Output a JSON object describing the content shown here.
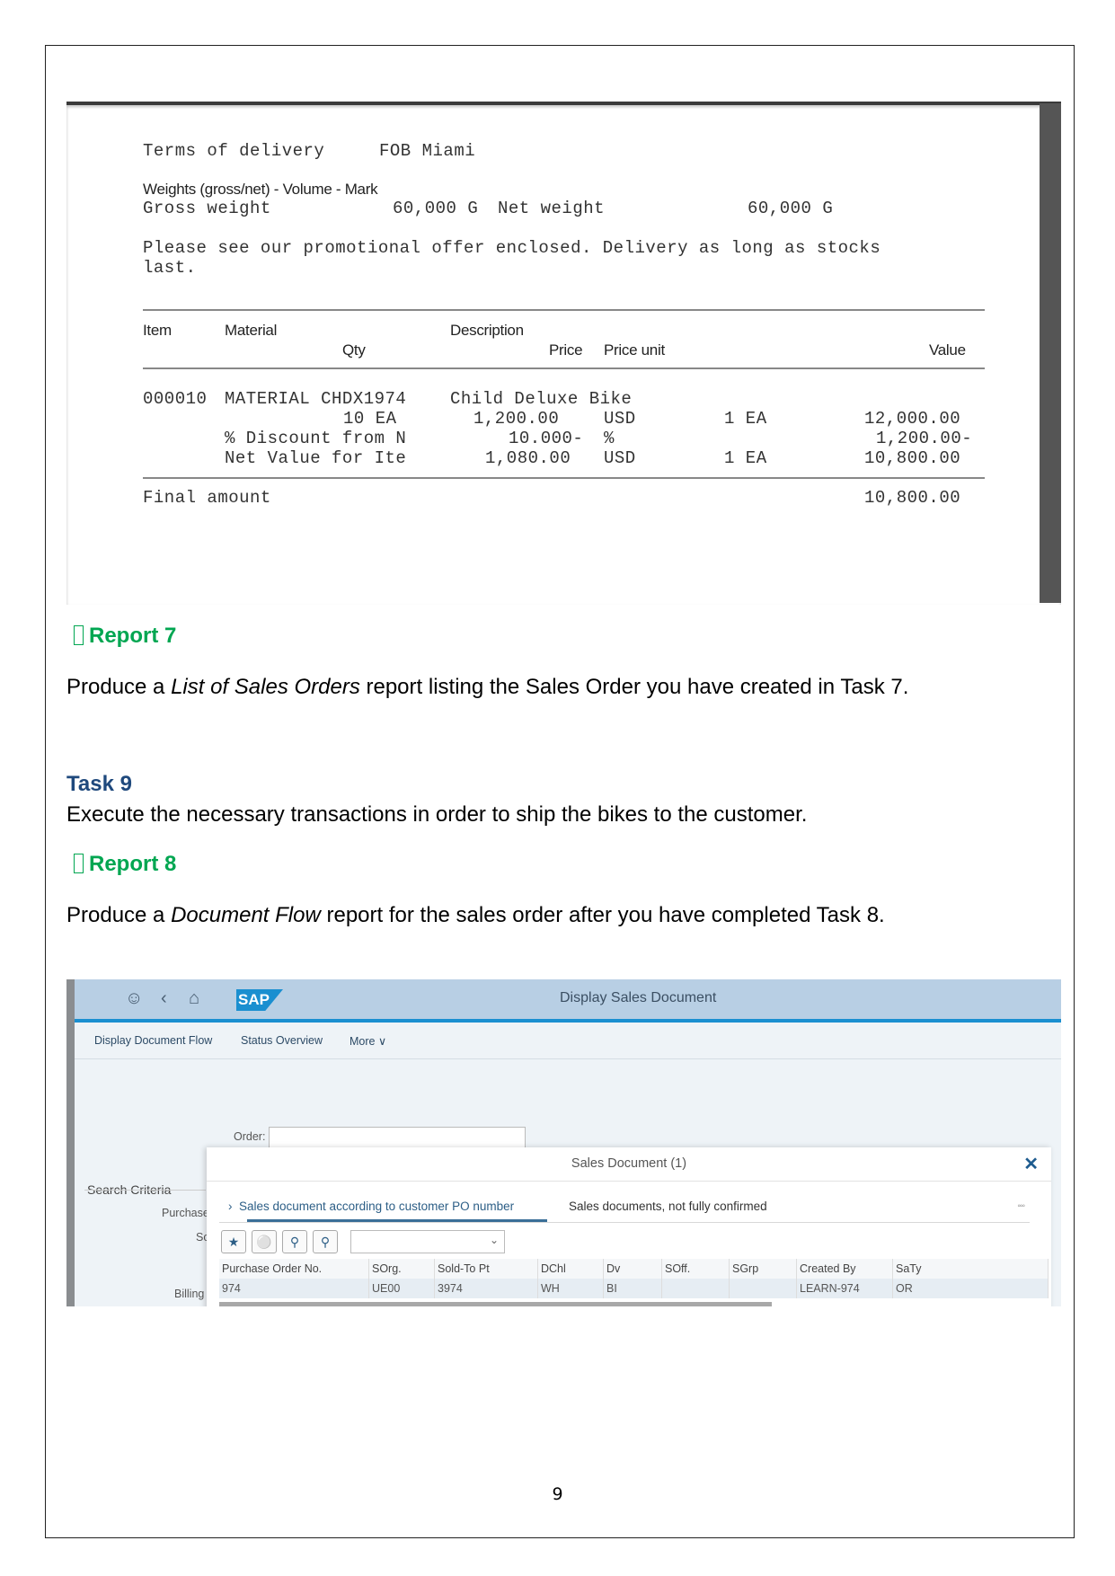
{
  "invoice": {
    "terms_label": "Terms of delivery",
    "terms_value": "FOB Miami",
    "weights_header": "Weights (gross/net) - Volume - Mark",
    "gross_weight_label": "Gross weight",
    "gross_weight_value": "60,000 G",
    "net_weight_label": "Net weight",
    "net_weight_value": "60,000 G",
    "promo_line1": "Please see our promotional offer enclosed. Delivery as long as stocks",
    "promo_line2": "last.",
    "columns": {
      "item": "Item",
      "material": "Material",
      "qty": "Qty",
      "description": "Description",
      "price": "Price",
      "price_unit": "Price unit",
      "value": "Value"
    },
    "line_item": {
      "item": "000010",
      "material": "MATERIAL CHDX1974",
      "description": "Child Deluxe Bike",
      "qty": "10 EA",
      "price": "1,200.00",
      "currency": "USD",
      "per": "1 EA",
      "value": "12,000.00"
    },
    "discount": {
      "label": "% Discount from N",
      "amount": "10.000-",
      "unit": "%",
      "value": "1,200.00-"
    },
    "net_value": {
      "label": "Net Value for Ite",
      "amount": "1,080.00",
      "currency": "USD",
      "per": "1 EA",
      "value": "10,800.00"
    },
    "final_label": "Final amount",
    "final_value": "10,800.00"
  },
  "report7": {
    "heading": "Report 7",
    "text_before": "Produce a ",
    "text_italic": "List of Sales Orders",
    "text_after": " report listing the Sales Order you have created in Task 7."
  },
  "task9": {
    "heading": "Task 9",
    "text": "Execute the necessary transactions in order to ship the bikes to the customer."
  },
  "report8": {
    "heading": "Report 8",
    "text_before": "Produce a ",
    "text_italic": "Document Flow",
    "text_after": " report for the sales order after you have completed Task 8."
  },
  "sap": {
    "logo": "SAP",
    "title": "Display Sales Document",
    "toolbar": [
      "Display Document Flow",
      "Status Overview",
      "More ∨"
    ],
    "order_label": "Order:",
    "order_value": "",
    "search_criteria": "Search Criteria",
    "labels": [
      "Purchase",
      "So",
      "Billing"
    ],
    "dialog": {
      "title": "Sales Document (1)",
      "close": "✕",
      "tab_active": "Sales document according to customer PO number",
      "tab_other": "Sales documents, not fully confirmed",
      "more": "◦◦◦",
      "columns": [
        "Purchase Order No.",
        "SOrg.",
        "Sold-To Pt",
        "DChl",
        "Dv",
        "SOff.",
        "SGrp",
        "Created By",
        "SaTy"
      ],
      "rows": [
        [
          "974",
          "UE00",
          "3974",
          "WH",
          "BI",
          "",
          "",
          "LEARN-974",
          "OR"
        ]
      ]
    }
  },
  "page_number": "9"
}
